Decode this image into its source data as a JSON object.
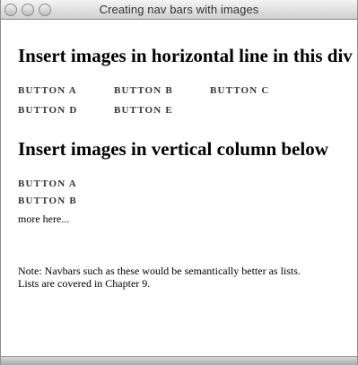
{
  "window": {
    "title": "Creating nav bars with images"
  },
  "horizontal_section": {
    "heading": "Insert images in horizontal line in this div",
    "buttons": [
      "BUTTON A",
      "BUTTON B",
      "BUTTON C",
      "BUTTON D",
      "BUTTON E"
    ]
  },
  "vertical_section": {
    "heading": "Insert images in vertical column below",
    "buttons": [
      "BUTTON A",
      "BUTTON B"
    ],
    "more_text": "more here..."
  },
  "note": {
    "line1": "Note: Navbars such as these would be semantically better as lists.",
    "line2": "Lists are covered in Chapter 9."
  },
  "colors": {
    "button_text": "#333333",
    "background": "#ffffff"
  }
}
